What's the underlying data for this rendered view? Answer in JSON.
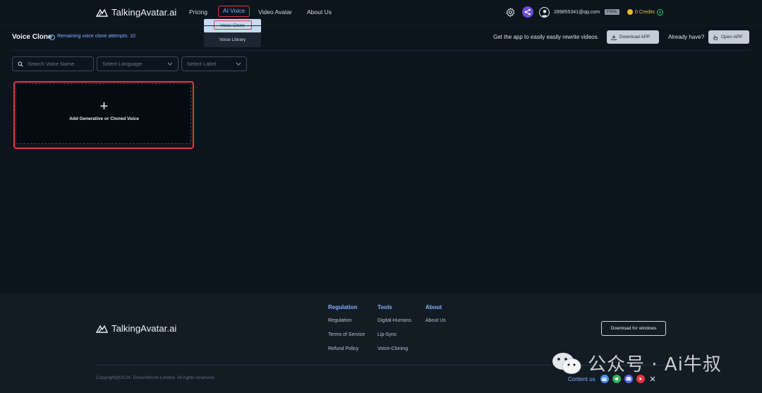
{
  "header": {
    "brand": "TalkingAvatar.ai",
    "nav": [
      {
        "label": "Pricing"
      },
      {
        "label": "AI Voice"
      },
      {
        "label": "Video Avatar"
      },
      {
        "label": "About Us"
      }
    ],
    "dropdown": {
      "items": [
        {
          "label": "Voice Clone"
        },
        {
          "label": "Voice Library"
        }
      ]
    },
    "user_email": "289855341@qq.com",
    "plan_badge": "FREE",
    "credits_label": "0 Credits",
    "icons": {
      "settings": "gear-icon",
      "share": "share-icon",
      "user": "user-avatar-icon",
      "add": "plus-circle-icon"
    },
    "colors": {
      "accent": "#7fb4ff",
      "share_bg": "#6b4bd8",
      "credits": "#f0c040",
      "highlight": "#e0383f"
    }
  },
  "subbar": {
    "title": "Voice Clone",
    "attempts": "Remaining voice clone attempts: 10",
    "promo": "Get the app to easily easily rewrite videos.",
    "download_label": "Download APP",
    "already_label": "Already have?",
    "open_label": "Open APP"
  },
  "filters": {
    "search_placeholder": "Search Voice Name",
    "language_placeholder": "Select Language",
    "label_placeholder": "Select Label"
  },
  "add_card": {
    "icon": "+",
    "label": "Add Generative or Cloned Voice"
  },
  "footer": {
    "brand": "TalkingAvatar.ai",
    "columns": [
      {
        "title": "Regulation",
        "links": [
          "Regulation",
          "Terms of Service",
          "Refund Policy"
        ]
      },
      {
        "title": "Tools",
        "links": [
          "Digital-Humans",
          "Lip-Sync",
          "Voice-Cloning"
        ]
      },
      {
        "title": "About",
        "links": [
          "About Us"
        ]
      }
    ],
    "download_windows": "Download for windows",
    "copyright": "Copyright@2024. DreamWorld Limited. All rights reserved.",
    "contact_label": "Content us",
    "social": [
      "email-icon",
      "telegram-icon",
      "discord-icon",
      "youtube-icon",
      "x-icon"
    ]
  },
  "watermark": {
    "text": "公众号 · Ai牛叔"
  }
}
